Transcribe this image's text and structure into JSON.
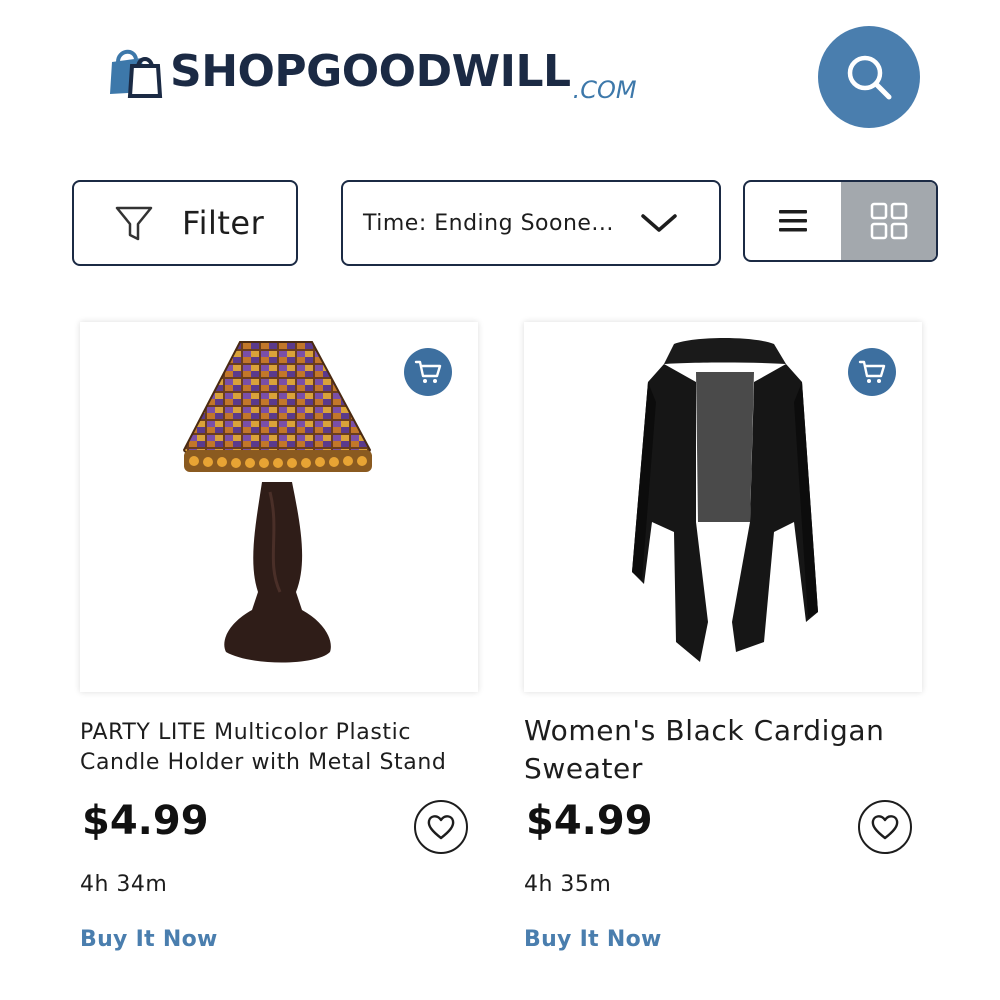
{
  "header": {
    "logo_text": "SHOPGOODWILL",
    "logo_suffix": ".COM",
    "search_icon": "search-icon"
  },
  "controls": {
    "filter_label": "Filter",
    "filter_icon": "funnel-icon",
    "sort_label": "Time: Ending Soone...",
    "view_list_icon": "list-view-icon",
    "view_grid_icon": "grid-view-icon",
    "active_view": "grid"
  },
  "colors": {
    "brand_navy": "#1b2a44",
    "brand_blue": "#4a7eae",
    "grid_active_bg": "#a3a8ad"
  },
  "products": [
    {
      "title": "PARTY LITE Multicolor Plastic Candle Holder with Metal Stand",
      "price": "$4.99",
      "time_left": "4h 34m",
      "action": "Buy It Now",
      "image": "mosaic-candle-lamp",
      "cart_icon": "cart-icon",
      "heart_icon": "heart-icon"
    },
    {
      "title": "Women's Black Cardigan Sweater",
      "price": "$4.99",
      "time_left": "4h 35m",
      "action": "Buy It Now",
      "image": "black-cardigan",
      "cart_icon": "cart-icon",
      "heart_icon": "heart-icon"
    }
  ]
}
